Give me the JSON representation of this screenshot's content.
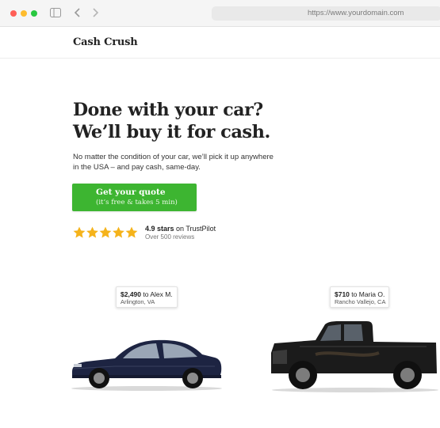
{
  "browser": {
    "url": "https://www.yourdomain.com"
  },
  "site": {
    "brand": "Cash Crush"
  },
  "hero": {
    "title": "Done with your car?",
    "subtitle": "We’ll buy it for cash.",
    "description": "No matter the condition of your car, we’ll pick it up anywhere in the USA – and pay cash, same-day."
  },
  "cta": {
    "label": "Get your quote",
    "sublabel": "(it’s free & takes 5 min)",
    "color": "#3db531"
  },
  "rating": {
    "stars": 5,
    "score_text": "4.9 stars",
    "source_text": "on TrustPilot",
    "reviews_text": "Over 500 reviews",
    "star_color": "#f5b31b"
  },
  "offers": [
    {
      "amount": "$2,490",
      "to_text": "to Alex M.",
      "location": "Arlington, VA",
      "vehicle_icon": "sedan-icon"
    },
    {
      "amount": "$710",
      "to_text": "to Maria O.",
      "location": "Rancho Vallejo, CA",
      "vehicle_icon": "pickup-truck-icon"
    }
  ]
}
